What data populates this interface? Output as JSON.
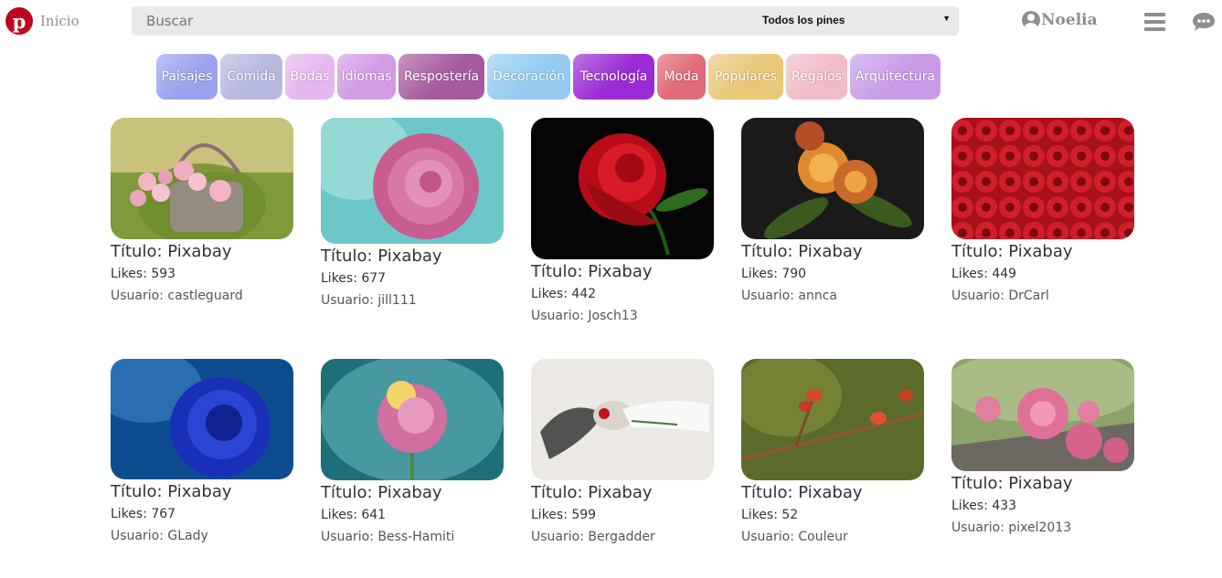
{
  "header": {
    "logo_letter": "p",
    "home_label": "Inicio",
    "search_placeholder": "Buscar",
    "filter_selected": "Todos los pines",
    "user_name": "Noelia",
    "icons": [
      "pinterest-logo",
      "user-circle-icon",
      "hamburger-menu-icon",
      "chat-bubble-icon",
      "caret-down-icon"
    ]
  },
  "categories": [
    {
      "label": "Paisajes",
      "bg": "#9aa3ee"
    },
    {
      "label": "Comida",
      "bg": "#b7b8e0"
    },
    {
      "label": "Bodas",
      "bg": "#e4b7ef"
    },
    {
      "label": "Idiomas",
      "bg": "#d39ae6"
    },
    {
      "label": "Respostería",
      "bg": "#a65a9e"
    },
    {
      "label": "Decoración",
      "bg": "#93ccf0"
    },
    {
      "label": "Tecnología",
      "bg": "#9a2ad4"
    },
    {
      "label": "Moda",
      "bg": "#e06a76"
    },
    {
      "label": "Populares",
      "bg": "#e8c878"
    },
    {
      "label": "Regalos",
      "bg": "#f1bcc8"
    },
    {
      "label": "Arquitectura",
      "bg": "#c79be8"
    }
  ],
  "pins": [
    {
      "title": "Título: Pixabay",
      "likes": "Likes: 593",
      "user": "Usuario: castleguard",
      "image": "pink roses in basket on grass"
    },
    {
      "title": "Título: Pixabay",
      "likes": "Likes: 677",
      "user": "Usuario: jill111",
      "image": "pink rose on teal background"
    },
    {
      "title": "Título: Pixabay",
      "likes": "Likes: 442",
      "user": "Usuario: Josch13",
      "image": "red rose on black background"
    },
    {
      "title": "Título: Pixabay",
      "likes": "Likes: 790",
      "user": "Usuario: annca",
      "image": "orange roses on dark background"
    },
    {
      "title": "Título: Pixabay",
      "likes": "Likes: 449",
      "user": "Usuario: DrCarl",
      "image": "field of red roses"
    },
    {
      "title": "Título: Pixabay",
      "likes": "Likes: 767",
      "user": "Usuario: GLady",
      "image": "blue rose with water drops"
    },
    {
      "title": "Título: Pixabay",
      "likes": "Likes: 641",
      "user": "Usuario: Bess-Hamiti",
      "image": "pastel rose on teal background"
    },
    {
      "title": "Título: Pixabay",
      "likes": "Likes: 599",
      "user": "Usuario: Bergadder",
      "image": "woman lying with red rose"
    },
    {
      "title": "Título: Pixabay",
      "likes": "Likes: 52",
      "user": "Usuario: Couleur",
      "image": "rose hips on branch"
    },
    {
      "title": "Título: Pixabay",
      "likes": "Likes: 433",
      "user": "Usuario: pixel2013",
      "image": "pink roses on wooden log"
    }
  ]
}
